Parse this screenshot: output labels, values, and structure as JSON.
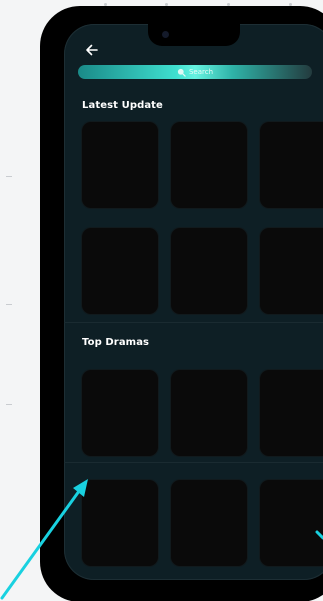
{
  "header": {
    "back_label": "←"
  },
  "search": {
    "placeholder": "Search"
  },
  "sections": [
    {
      "title": "Latest Update"
    },
    {
      "title": "Top Dramas"
    }
  ],
  "icons": {
    "back": "arrow-left-icon",
    "search": "search-icon"
  },
  "colors": {
    "screen_bg": "#0e1f25",
    "card_bg": "#0a0a0a",
    "accent": "#3fe0d0",
    "annotation_arrow": "#19d1e0"
  }
}
